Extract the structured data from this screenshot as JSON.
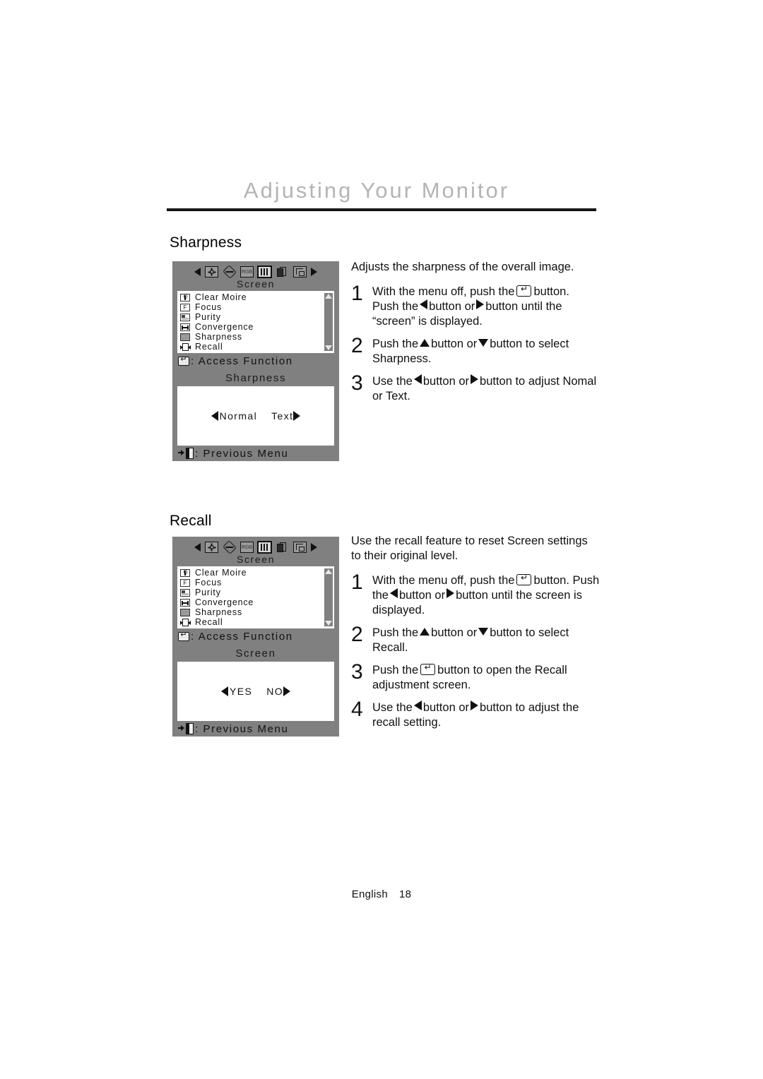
{
  "header": {
    "title": "Adjusting Your Monitor"
  },
  "footer": {
    "language": "English",
    "page_number": "18"
  },
  "osd_common": {
    "tab_label": "Screen",
    "access_function_label": ": Access Function",
    "previous_menu_label": ": Previous Menu",
    "tabs": [
      {
        "name": "prev-arrow",
        "icon": "left-arrow-icon"
      },
      {
        "name": "position",
        "icon": "position-move-icon"
      },
      {
        "name": "geometry",
        "icon": "geometry-diamond-icon"
      },
      {
        "name": "color",
        "icon": "rgb-icon",
        "label": "RGB"
      },
      {
        "name": "screen",
        "icon": "screen-bars-icon",
        "selected": true
      },
      {
        "name": "osd",
        "icon": "osd-pages-icon"
      },
      {
        "name": "information",
        "icon": "layout-info-icon"
      },
      {
        "name": "next-arrow",
        "icon": "right-arrow-icon"
      }
    ],
    "menu_items": [
      {
        "label": "Clear Moire",
        "icon": "clear-moire-icon"
      },
      {
        "label": "Focus",
        "icon": "focus-icon"
      },
      {
        "label": "Purity",
        "icon": "purity-icon"
      },
      {
        "label": "Convergence",
        "icon": "convergence-icon"
      },
      {
        "label": "Sharpness",
        "icon": "sharpness-icon"
      },
      {
        "label": "Recall",
        "icon": "recall-icon"
      }
    ]
  },
  "sharpness": {
    "section_title": "Sharpness",
    "value_panel": {
      "title": "Sharpness",
      "option_left": "Normal",
      "option_right": "Text"
    },
    "intro": "Adjusts the sharpness of the overall image.",
    "steps": [
      {
        "num": "1",
        "parts": [
          {
            "t": "text",
            "v": "With the menu off, push the"
          },
          {
            "t": "icon",
            "v": "enter-button-icon"
          },
          {
            "t": "text",
            "v": "button. Push the"
          },
          {
            "t": "icon",
            "v": "left-arrow-icon"
          },
          {
            "t": "text",
            "v": "button or"
          },
          {
            "t": "icon",
            "v": "right-arrow-icon"
          },
          {
            "t": "text",
            "v": "button until the “screen” is displayed."
          }
        ]
      },
      {
        "num": "2",
        "parts": [
          {
            "t": "text",
            "v": "Push the"
          },
          {
            "t": "icon",
            "v": "up-arrow-icon"
          },
          {
            "t": "text",
            "v": "button or"
          },
          {
            "t": "icon",
            "v": "down-arrow-icon"
          },
          {
            "t": "text",
            "v": "button to select Sharpness."
          }
        ]
      },
      {
        "num": "3",
        "parts": [
          {
            "t": "text",
            "v": "Use the"
          },
          {
            "t": "icon",
            "v": "left-arrow-icon"
          },
          {
            "t": "text",
            "v": "button or"
          },
          {
            "t": "icon",
            "v": "right-arrow-icon"
          },
          {
            "t": "text",
            "v": "button to adjust Nomal or Text."
          }
        ]
      }
    ],
    "step1_a": "With the menu off, push the",
    "step1_b": "button.",
    "step1_c": "Push the",
    "step1_d": "button or",
    "step1_e": "button until the",
    "step1_f": "“screen” is displayed.",
    "step2_a": "Push the",
    "step2_b": "button or",
    "step2_c": "button to select",
    "step2_d": "Sharpness",
    "step2_e": ".",
    "step3_a": "Use the",
    "step3_b": "button or",
    "step3_c": "button to adjust",
    "step3_d": "Nomal or Text."
  },
  "recall": {
    "section_title": "Recall",
    "value_panel": {
      "title": "Screen",
      "option_left": "YES",
      "option_right": "NO"
    },
    "intro": "Use the recall feature to reset Screen settings to their original level.",
    "step1_a": "With the menu off, push the",
    "step1_b": "button.",
    "step1_c": "Push the",
    "step1_d": "button or",
    "step1_e": "button until the",
    "step1_f": "screen is displayed.",
    "step2_a": "Push the",
    "step2_b": "button or",
    "step2_c": "button to select",
    "step2_d": "Recall",
    "step2_e": ".",
    "step3_a": "Push the",
    "step3_b": "button to open the Recall",
    "step3_c": "adjustment screen.",
    "step4_a": "Use the",
    "step4_b": "button or",
    "step4_c": "button to adjust the",
    "step4_d": "recall setting.",
    "step_numbers": {
      "one": "1",
      "two": "2",
      "three": "3",
      "four": "4"
    }
  },
  "step_numbers": {
    "one": "1",
    "two": "2",
    "three": "3"
  },
  "colors": {
    "osd_background": "#808080",
    "osd_panel": "#ffffff",
    "header_title": "#b4b4b4",
    "text": "#111111"
  }
}
